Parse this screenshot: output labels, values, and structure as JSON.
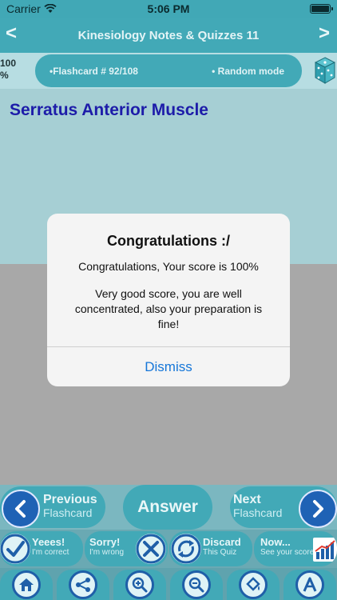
{
  "status_bar": {
    "carrier": "Carrier",
    "time": "5:06 PM"
  },
  "nav": {
    "title": "Kinesiology Notes & Quizzes 11",
    "back": "<",
    "forward": ">"
  },
  "info": {
    "score_line1": "100",
    "score_line2": "%",
    "flashcard": "•Flashcard #  92/108",
    "mode": "• Random mode"
  },
  "card": {
    "title": "Serratus Anterior Muscle"
  },
  "alert": {
    "title": "Congratulations :/",
    "message": "Congratulations, Your score is 100%",
    "detail": "Very good score, you are well concentrated, also your preparation is fine!",
    "dismiss": "Dismiss"
  },
  "toolbar": {
    "previous": {
      "big": "Previous",
      "small": "Flashcard"
    },
    "answer": "Answer",
    "next": {
      "big": "Next",
      "small": "Flashcard"
    },
    "yes": {
      "big": "Yeees!",
      "small": "I'm correct"
    },
    "sorry": {
      "big": "Sorry!",
      "small": "I'm wrong"
    },
    "discard": {
      "big": "Discard",
      "small": "This Quiz"
    },
    "now": {
      "big": "Now...",
      "small": "See your score"
    }
  },
  "colors": {
    "teal": "#42a9b7",
    "navy": "#1d1ca9",
    "link_blue": "#1576d8"
  }
}
